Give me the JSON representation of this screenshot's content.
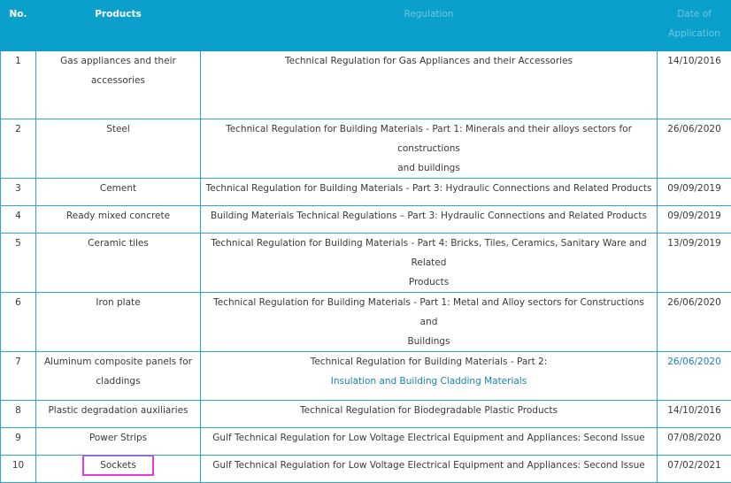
{
  "header": {
    "no": "No.",
    "products": "Products",
    "regulation": "Regulation",
    "date_line1": "Date of",
    "date_line2": "Application"
  },
  "rows": [
    {
      "no": "1",
      "product_l1": "Gas appliances and their",
      "product_l2": "accessories",
      "reg_l1": "Technical Regulation for Gas Appliances and their Accessories",
      "reg_l2": "",
      "date": "14/10/2016"
    },
    {
      "no": "2",
      "product_l1": "Steel",
      "product_l2": "",
      "reg_l1": "Technical Regulation for Building Materials - Part 1: Minerals and their alloys sectors for constructions",
      "reg_l2": "and buildings",
      "date": "26/06/2020"
    },
    {
      "no": "3",
      "product_l1": "Cement",
      "product_l2": "",
      "reg_l1": "Technical Regulation for Building Materials - Part 3: Hydraulic Connections and Related Products",
      "reg_l2": "",
      "date": "09/09/2019"
    },
    {
      "no": "4",
      "product_l1": "Ready mixed concrete",
      "product_l2": "",
      "reg_l1": "Building Materials Technical Regulations – Part 3: Hydraulic Connections and Related Products",
      "reg_l2": "",
      "date": "09/09/2019"
    },
    {
      "no": "5",
      "product_l1": "Ceramic tiles",
      "product_l2": "",
      "reg_l1": "Technical Regulation for Building Materials - Part 4: Bricks, Tiles, Ceramics, Sanitary Ware and Related",
      "reg_l2": "Products",
      "date": "13/09/2019"
    },
    {
      "no": "6",
      "product_l1": "Iron plate",
      "product_l2": "",
      "reg_l1": "Technical Regulation for Building Materials - Part 1: Metal and Alloy sectors for Constructions and",
      "reg_l2": "Buildings",
      "date": "26/06/2020"
    },
    {
      "no": "7",
      "product_l1": "Aluminum composite panels for",
      "product_l2": "claddings",
      "reg_l1": "Technical Regulation for Building Materials - Part 2:",
      "reg_l2": "Insulation and Building Cladding Materials",
      "date": "26/06/2020"
    },
    {
      "no": "8",
      "product_l1": "Plastic degradation auxiliaries",
      "product_l2": "",
      "reg_l1": "Technical Regulation for Biodegradable Plastic Products",
      "reg_l2": "",
      "date": "14/10/2016"
    },
    {
      "no": "9",
      "product_l1": "Power Strips",
      "product_l2": "",
      "reg_l1": "Gulf Technical Regulation for Low Voltage Electrical Equipment and Appliances: Second Issue",
      "reg_l2": "",
      "date": "07/08/2020"
    },
    {
      "no": "10",
      "product_l1": "Sockets",
      "product_l2": "",
      "reg_l1": "Gulf Technical Regulation for Low Voltage Electrical Equipment and Appliances: Second Issue",
      "reg_l2": "",
      "date": "07/02/2021"
    }
  ],
  "colors": {
    "header_bg": "#0b9fcb",
    "border": "#2aa8cf",
    "highlight": "#e63ae0",
    "link": "#1a7fb5"
  }
}
